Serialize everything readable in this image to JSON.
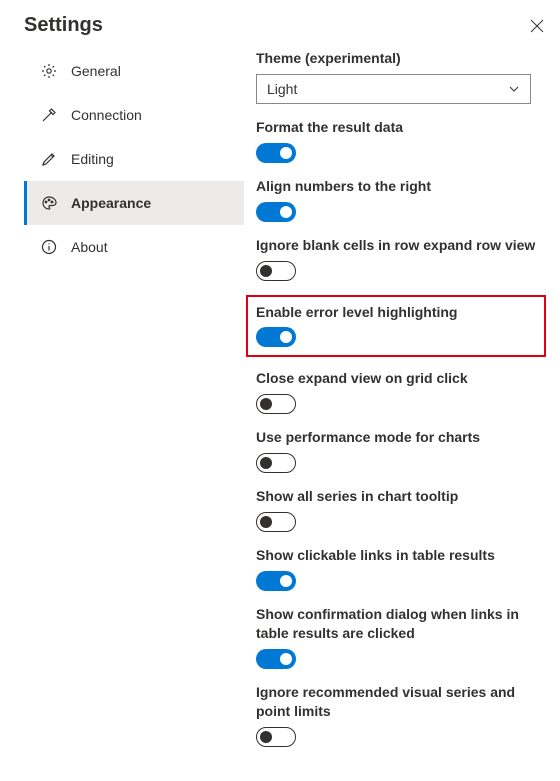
{
  "title": "Settings",
  "sidebar": {
    "items": [
      {
        "label": "General"
      },
      {
        "label": "Connection"
      },
      {
        "label": "Editing"
      },
      {
        "label": "Appearance"
      },
      {
        "label": "About"
      }
    ]
  },
  "theme": {
    "label": "Theme (experimental)",
    "value": "Light"
  },
  "settings": [
    {
      "label": "Format the result data",
      "on": true
    },
    {
      "label": "Align numbers to the right",
      "on": true
    },
    {
      "label": "Ignore blank cells in row expand row view",
      "on": false
    },
    {
      "label": "Enable error level highlighting",
      "on": true
    },
    {
      "label": "Close expand view on grid click",
      "on": false
    },
    {
      "label": "Use performance mode for charts",
      "on": false
    },
    {
      "label": "Show all series in chart tooltip",
      "on": false
    },
    {
      "label": "Show clickable links in table results",
      "on": true
    },
    {
      "label": "Show confirmation dialog when links in table results are clicked",
      "on": true
    },
    {
      "label": "Ignore recommended visual series and point limits",
      "on": false
    }
  ]
}
